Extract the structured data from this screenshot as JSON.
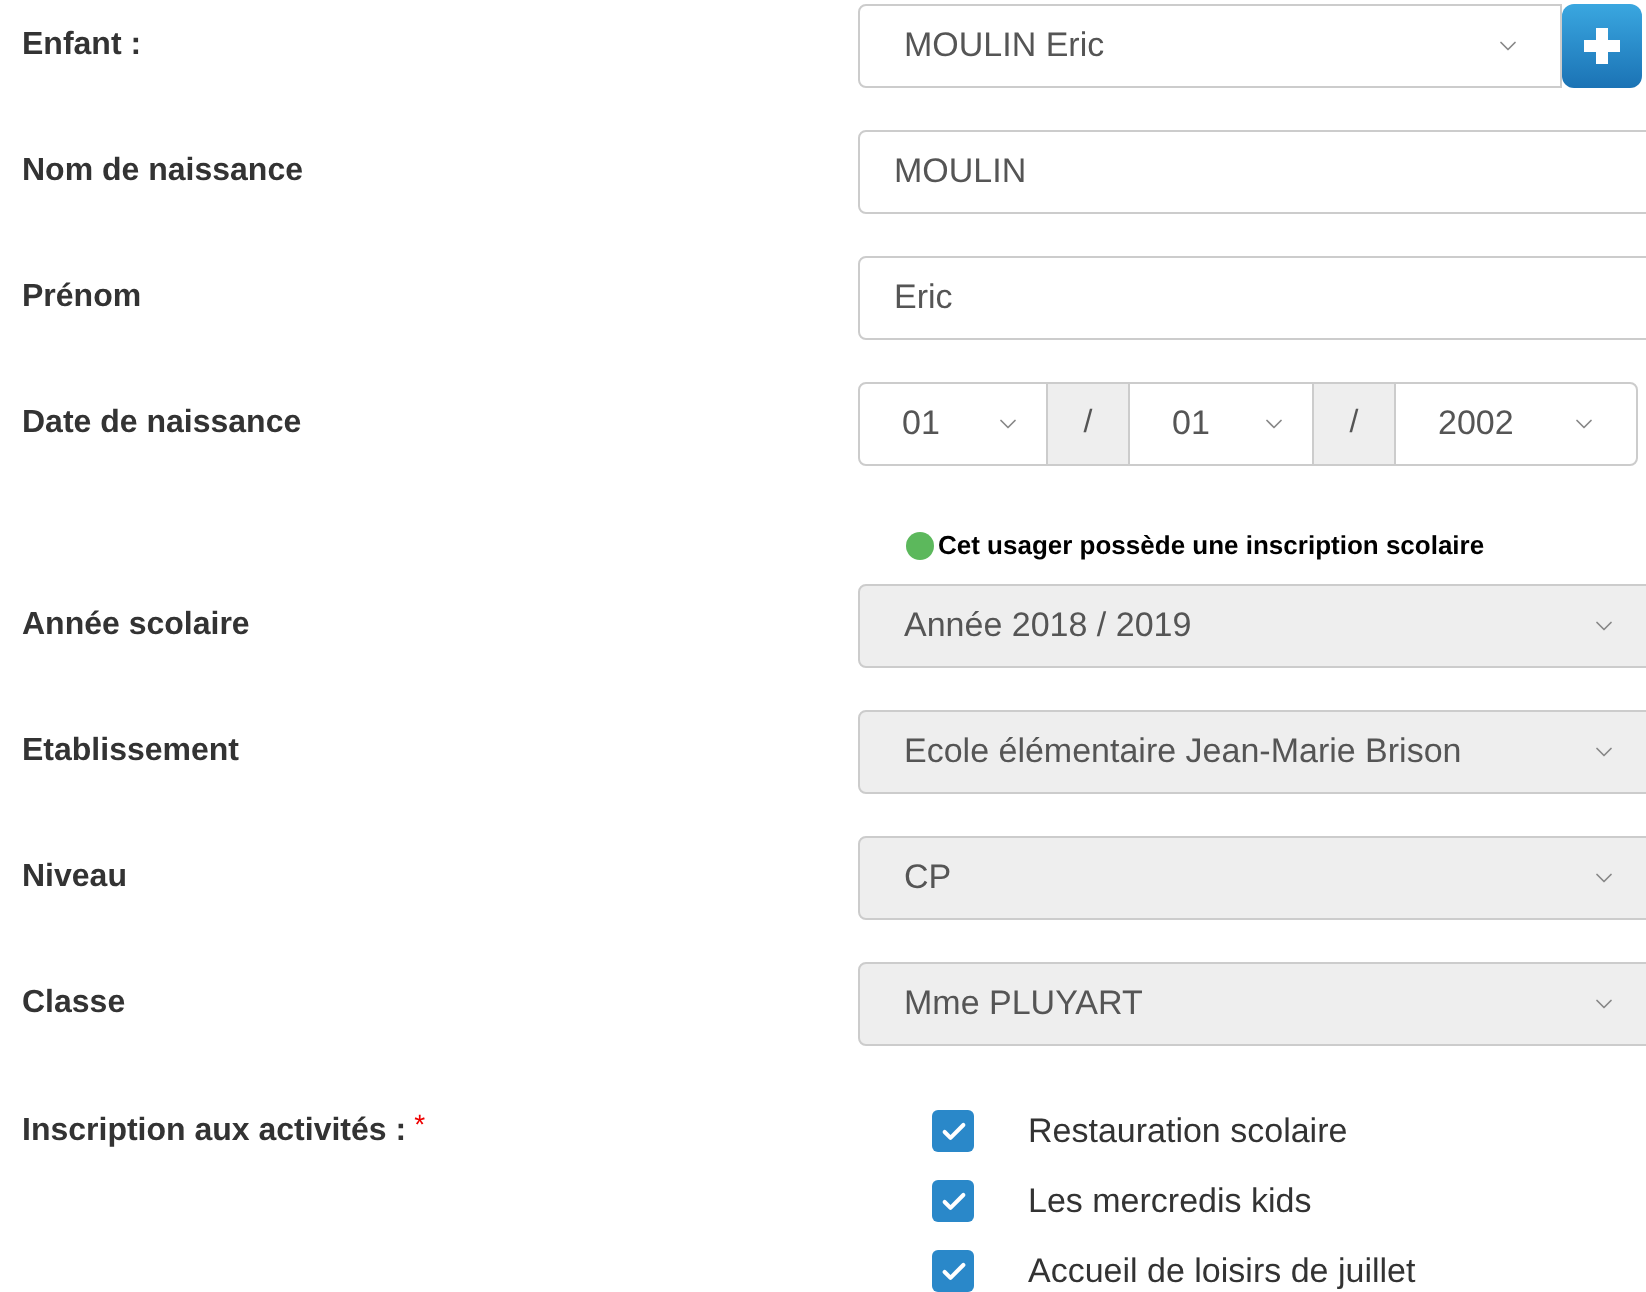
{
  "fields": [
    {
      "kind": "select",
      "label": "Enfant :",
      "value": "MOULIN Eric",
      "disabled": false,
      "add_button": true
    },
    {
      "kind": "text",
      "label": "Nom de naissance",
      "value": "MOULIN"
    },
    {
      "kind": "text",
      "label": "Prénom",
      "value": "Eric"
    },
    {
      "kind": "date",
      "label": "Date de naissance",
      "day": "01",
      "month": "01",
      "year": "2002",
      "separators": [
        "/",
        "/"
      ]
    },
    {
      "kind": "note",
      "text": "Cet usager possède une inscription scolaire"
    },
    {
      "kind": "select",
      "label": "Année scolaire",
      "value": "Année 2018 / 2019",
      "disabled": true,
      "add_button": false
    },
    {
      "kind": "select",
      "label": "Etablissement",
      "value": "Ecole élémentaire Jean-Marie Brison",
      "disabled": true,
      "add_button": false
    },
    {
      "kind": "select",
      "label": "Niveau",
      "value": "CP",
      "disabled": true,
      "add_button": false
    },
    {
      "kind": "select",
      "label": "Classe",
      "value": "Mme PLUYART",
      "disabled": true,
      "add_button": false
    }
  ],
  "activities": {
    "label": "Inscription aux activités :",
    "required_mark": "*",
    "items": [
      {
        "label": "Restauration scolaire",
        "checked": true
      },
      {
        "label": "Les mercredis kids",
        "checked": true
      },
      {
        "label": "Accueil de loisirs de juillet",
        "checked": true
      }
    ]
  }
}
